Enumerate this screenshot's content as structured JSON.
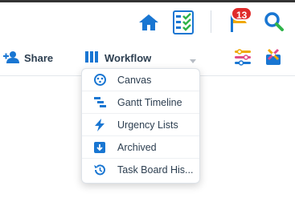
{
  "top_bar": {
    "notification_count": "13",
    "icons": [
      "home-icon",
      "tasks-checklist-icon",
      "notification-flag-icon",
      "search-icon"
    ]
  },
  "toolbar": {
    "share_label": "Share",
    "workflow_label": "Workflow"
  },
  "workflow_menu": {
    "items": [
      {
        "label": "Canvas",
        "icon": "canvas-icon"
      },
      {
        "label": "Gantt Timeline",
        "icon": "gantt-icon"
      },
      {
        "label": "Urgency Lists",
        "icon": "lightning-icon"
      },
      {
        "label": "Archived",
        "icon": "archive-icon"
      },
      {
        "label": "Task Board His...",
        "icon": "history-icon"
      }
    ]
  },
  "colors": {
    "accent": "#1976d2",
    "badge": "#e02b2b",
    "success": "#2fb34a"
  }
}
